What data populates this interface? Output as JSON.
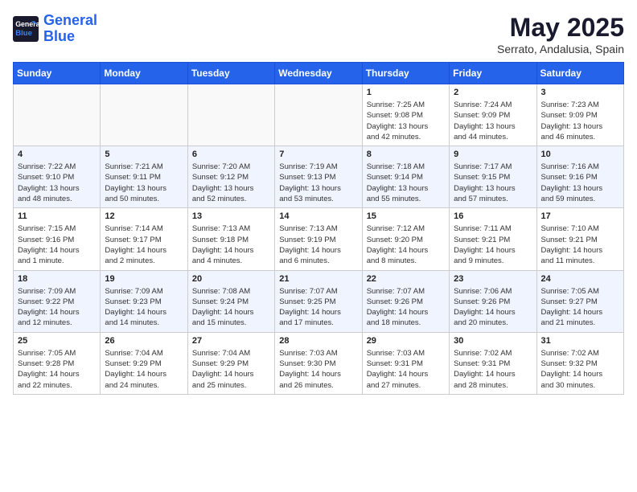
{
  "header": {
    "logo_line1": "General",
    "logo_line2": "Blue",
    "month_year": "May 2025",
    "location": "Serrato, Andalusia, Spain"
  },
  "weekdays": [
    "Sunday",
    "Monday",
    "Tuesday",
    "Wednesday",
    "Thursday",
    "Friday",
    "Saturday"
  ],
  "weeks": [
    [
      {
        "day": "",
        "info": ""
      },
      {
        "day": "",
        "info": ""
      },
      {
        "day": "",
        "info": ""
      },
      {
        "day": "",
        "info": ""
      },
      {
        "day": "1",
        "info": "Sunrise: 7:25 AM\nSunset: 9:08 PM\nDaylight: 13 hours\nand 42 minutes."
      },
      {
        "day": "2",
        "info": "Sunrise: 7:24 AM\nSunset: 9:09 PM\nDaylight: 13 hours\nand 44 minutes."
      },
      {
        "day": "3",
        "info": "Sunrise: 7:23 AM\nSunset: 9:09 PM\nDaylight: 13 hours\nand 46 minutes."
      }
    ],
    [
      {
        "day": "4",
        "info": "Sunrise: 7:22 AM\nSunset: 9:10 PM\nDaylight: 13 hours\nand 48 minutes."
      },
      {
        "day": "5",
        "info": "Sunrise: 7:21 AM\nSunset: 9:11 PM\nDaylight: 13 hours\nand 50 minutes."
      },
      {
        "day": "6",
        "info": "Sunrise: 7:20 AM\nSunset: 9:12 PM\nDaylight: 13 hours\nand 52 minutes."
      },
      {
        "day": "7",
        "info": "Sunrise: 7:19 AM\nSunset: 9:13 PM\nDaylight: 13 hours\nand 53 minutes."
      },
      {
        "day": "8",
        "info": "Sunrise: 7:18 AM\nSunset: 9:14 PM\nDaylight: 13 hours\nand 55 minutes."
      },
      {
        "day": "9",
        "info": "Sunrise: 7:17 AM\nSunset: 9:15 PM\nDaylight: 13 hours\nand 57 minutes."
      },
      {
        "day": "10",
        "info": "Sunrise: 7:16 AM\nSunset: 9:16 PM\nDaylight: 13 hours\nand 59 minutes."
      }
    ],
    [
      {
        "day": "11",
        "info": "Sunrise: 7:15 AM\nSunset: 9:16 PM\nDaylight: 14 hours\nand 1 minute."
      },
      {
        "day": "12",
        "info": "Sunrise: 7:14 AM\nSunset: 9:17 PM\nDaylight: 14 hours\nand 2 minutes."
      },
      {
        "day": "13",
        "info": "Sunrise: 7:13 AM\nSunset: 9:18 PM\nDaylight: 14 hours\nand 4 minutes."
      },
      {
        "day": "14",
        "info": "Sunrise: 7:13 AM\nSunset: 9:19 PM\nDaylight: 14 hours\nand 6 minutes."
      },
      {
        "day": "15",
        "info": "Sunrise: 7:12 AM\nSunset: 9:20 PM\nDaylight: 14 hours\nand 8 minutes."
      },
      {
        "day": "16",
        "info": "Sunrise: 7:11 AM\nSunset: 9:21 PM\nDaylight: 14 hours\nand 9 minutes."
      },
      {
        "day": "17",
        "info": "Sunrise: 7:10 AM\nSunset: 9:21 PM\nDaylight: 14 hours\nand 11 minutes."
      }
    ],
    [
      {
        "day": "18",
        "info": "Sunrise: 7:09 AM\nSunset: 9:22 PM\nDaylight: 14 hours\nand 12 minutes."
      },
      {
        "day": "19",
        "info": "Sunrise: 7:09 AM\nSunset: 9:23 PM\nDaylight: 14 hours\nand 14 minutes."
      },
      {
        "day": "20",
        "info": "Sunrise: 7:08 AM\nSunset: 9:24 PM\nDaylight: 14 hours\nand 15 minutes."
      },
      {
        "day": "21",
        "info": "Sunrise: 7:07 AM\nSunset: 9:25 PM\nDaylight: 14 hours\nand 17 minutes."
      },
      {
        "day": "22",
        "info": "Sunrise: 7:07 AM\nSunset: 9:26 PM\nDaylight: 14 hours\nand 18 minutes."
      },
      {
        "day": "23",
        "info": "Sunrise: 7:06 AM\nSunset: 9:26 PM\nDaylight: 14 hours\nand 20 minutes."
      },
      {
        "day": "24",
        "info": "Sunrise: 7:05 AM\nSunset: 9:27 PM\nDaylight: 14 hours\nand 21 minutes."
      }
    ],
    [
      {
        "day": "25",
        "info": "Sunrise: 7:05 AM\nSunset: 9:28 PM\nDaylight: 14 hours\nand 22 minutes."
      },
      {
        "day": "26",
        "info": "Sunrise: 7:04 AM\nSunset: 9:29 PM\nDaylight: 14 hours\nand 24 minutes."
      },
      {
        "day": "27",
        "info": "Sunrise: 7:04 AM\nSunset: 9:29 PM\nDaylight: 14 hours\nand 25 minutes."
      },
      {
        "day": "28",
        "info": "Sunrise: 7:03 AM\nSunset: 9:30 PM\nDaylight: 14 hours\nand 26 minutes."
      },
      {
        "day": "29",
        "info": "Sunrise: 7:03 AM\nSunset: 9:31 PM\nDaylight: 14 hours\nand 27 minutes."
      },
      {
        "day": "30",
        "info": "Sunrise: 7:02 AM\nSunset: 9:31 PM\nDaylight: 14 hours\nand 28 minutes."
      },
      {
        "day": "31",
        "info": "Sunrise: 7:02 AM\nSunset: 9:32 PM\nDaylight: 14 hours\nand 30 minutes."
      }
    ]
  ]
}
